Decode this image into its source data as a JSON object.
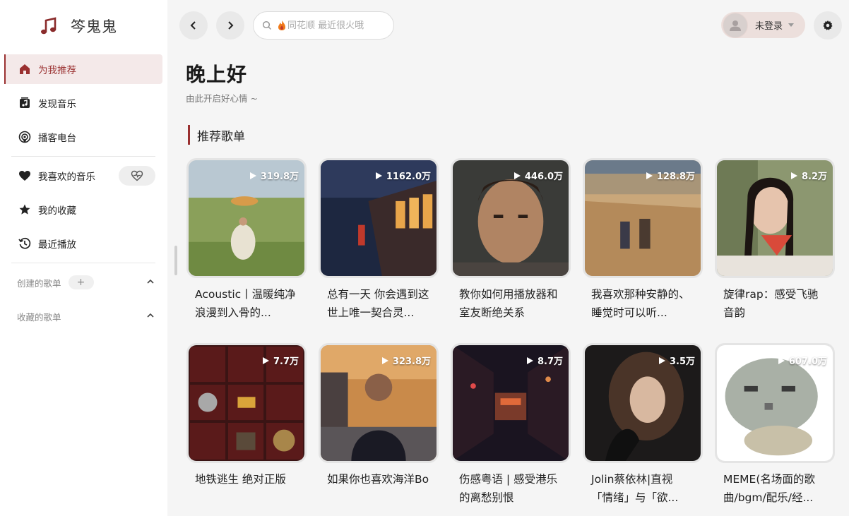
{
  "app": {
    "name": "笒鬼鬼"
  },
  "sidebar": {
    "nav": [
      {
        "label": "为我推荐",
        "icon": "home-icon",
        "active": true
      },
      {
        "label": "发现音乐",
        "icon": "music-library-icon"
      },
      {
        "label": "播客电台",
        "icon": "podcast-icon"
      }
    ],
    "library": [
      {
        "label": "我喜欢的音乐",
        "icon": "heart-icon"
      },
      {
        "label": "我的收藏",
        "icon": "star-icon"
      },
      {
        "label": "最近播放",
        "icon": "history-icon"
      }
    ],
    "created_playlists": {
      "label": "创建的歌单",
      "add": "+"
    },
    "saved_playlists": {
      "label": "收藏的歌单"
    }
  },
  "topbar": {
    "search_placeholder": "同花顺 最近很火哦",
    "user": {
      "name": "未登录"
    }
  },
  "main": {
    "greeting": "晚上好",
    "subgreeting": "由此开启好心情 ~",
    "section_title": "推荐歌单",
    "playlists": [
      {
        "title": "Acoustic丨温暖纯净 浪漫到入骨的...",
        "plays": "319.8万"
      },
      {
        "title": "总有一天 你会遇到这世上唯一契合灵...",
        "plays": "1162.0万"
      },
      {
        "title": "教你如何用播放器和室友断绝关系",
        "plays": "446.0万"
      },
      {
        "title": "我喜欢那种安静的、睡觉时可以听...",
        "plays": "128.8万"
      },
      {
        "title": "旋律rap：感受飞驰音韵",
        "plays": "8.2万"
      },
      {
        "title": "地铁逃生 绝对正版",
        "plays": "7.7万"
      },
      {
        "title": "如果你也喜欢海洋Bo",
        "plays": "323.8万"
      },
      {
        "title": "伤感粤语 | 感受港乐的离愁别恨",
        "plays": "8.7万"
      },
      {
        "title": "Jolin蔡依林|直视「情绪」与「欲...",
        "plays": "3.5万"
      },
      {
        "title": "MEME(名场面的歌曲/bgm/配乐/经...",
        "plays": "607.0万"
      }
    ]
  },
  "colors": {
    "accent": "#9a3030",
    "sidebar_bg": "#ffffff",
    "main_bg": "#f5f5f5"
  }
}
